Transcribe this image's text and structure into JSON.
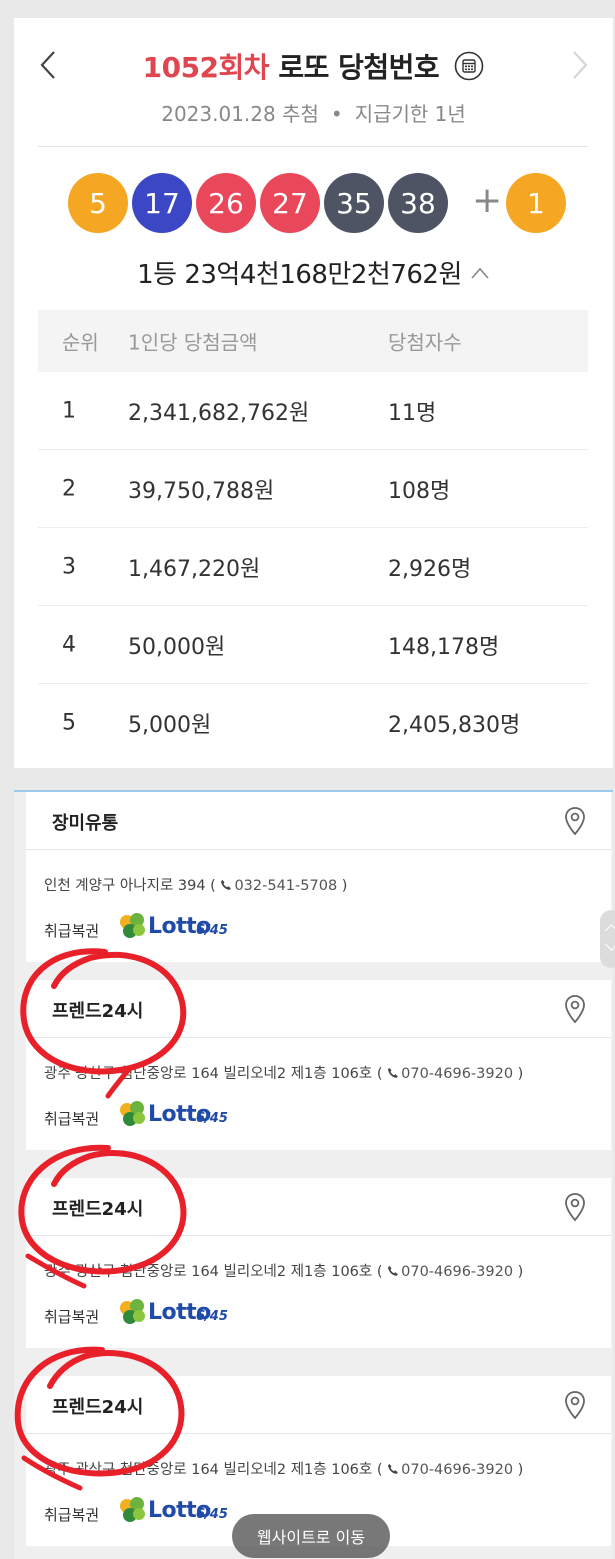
{
  "header": {
    "round": "1052회차",
    "title_rest": "로또 당첨번호",
    "date": "2023.01.28 추첨",
    "dot": "•",
    "deadline": "지급기한 1년"
  },
  "draw": {
    "numbers": [
      {
        "value": "5",
        "color": "#f5a623"
      },
      {
        "value": "17",
        "color": "#3b47c4"
      },
      {
        "value": "26",
        "color": "#e9485a"
      },
      {
        "value": "27",
        "color": "#e9485a"
      },
      {
        "value": "35",
        "color": "#4e5463"
      },
      {
        "value": "38",
        "color": "#4e5463"
      }
    ],
    "plus": "+",
    "bonus": {
      "value": "1",
      "color": "#f5a623"
    },
    "first_prize": "1등 23억4천168만2천762원"
  },
  "table": {
    "headers": [
      "순위",
      "1인당 당첨금액",
      "당첨자수"
    ],
    "rows": [
      [
        "1",
        "2,341,682,762원",
        "11명"
      ],
      [
        "2",
        "39,750,788원",
        "108명"
      ],
      [
        "3",
        "1,467,220원",
        "2,926명"
      ],
      [
        "4",
        "50,000원",
        "148,178명"
      ],
      [
        "5",
        "5,000원",
        "2,405,830명"
      ]
    ]
  },
  "stores": [
    {
      "name": "장미유통",
      "address": "인천 계양구 아나지로 394 (",
      "phone": "032-541-5708",
      "address_end": " )",
      "kind": "취급복권"
    },
    {
      "name": "프렌드24시",
      "address": "광주 광산구 첨단중앙로 164 빌리오네2 제1층 106호 (",
      "phone": "070-4696-3920",
      "address_end": " )",
      "kind": "취급복권"
    },
    {
      "name": "프렌드24시",
      "address": "광주 광산구 첨단중앙로 164 빌리오네2 제1층 106호 (",
      "phone": "070-4696-3920",
      "address_end": " )",
      "kind": "취급복권"
    },
    {
      "name": "프렌드24시",
      "address": "광주 광산구 첨단중앙로 164 빌리오네2 제1층 106호 (",
      "phone": "070-4696-3920",
      "address_end": " )",
      "kind": "취급복권"
    }
  ],
  "logo": {
    "text": "Lotto",
    "sub": "6/45"
  },
  "website_button": "웹사이트로 이동",
  "colors": {
    "accent_red": "#e0464f",
    "annotation": "#e8202a",
    "logo_blue": "#1f4aa8"
  },
  "icons": [
    "chevron-left-icon",
    "chevron-right-icon",
    "calendar-icon",
    "caret-up-icon",
    "map-pin-icon",
    "phone-icon"
  ]
}
